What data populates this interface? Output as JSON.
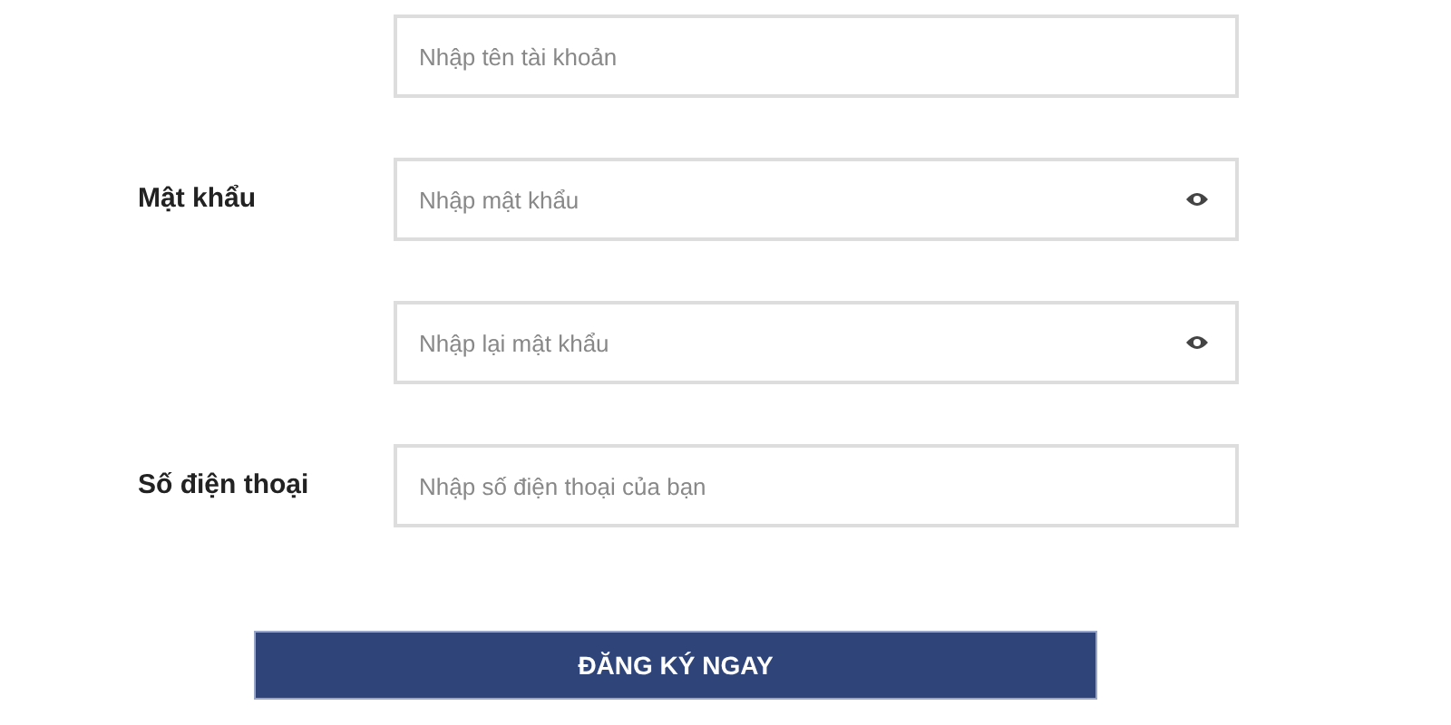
{
  "fields": [
    {
      "kind": "text",
      "placeholder": "Nhập tên tài khoản"
    },
    {
      "kind": "password",
      "label": "Mật khẩu",
      "placeholder": "Nhập mật khẩu"
    },
    {
      "kind": "password",
      "placeholder": "Nhập lại mật khẩu"
    },
    {
      "kind": "text",
      "label": "Số điện thoại",
      "placeholder": "Nhập số điện thoại của bạn"
    }
  ],
  "submit": {
    "label": "ĐĂNG KÝ NGAY"
  }
}
